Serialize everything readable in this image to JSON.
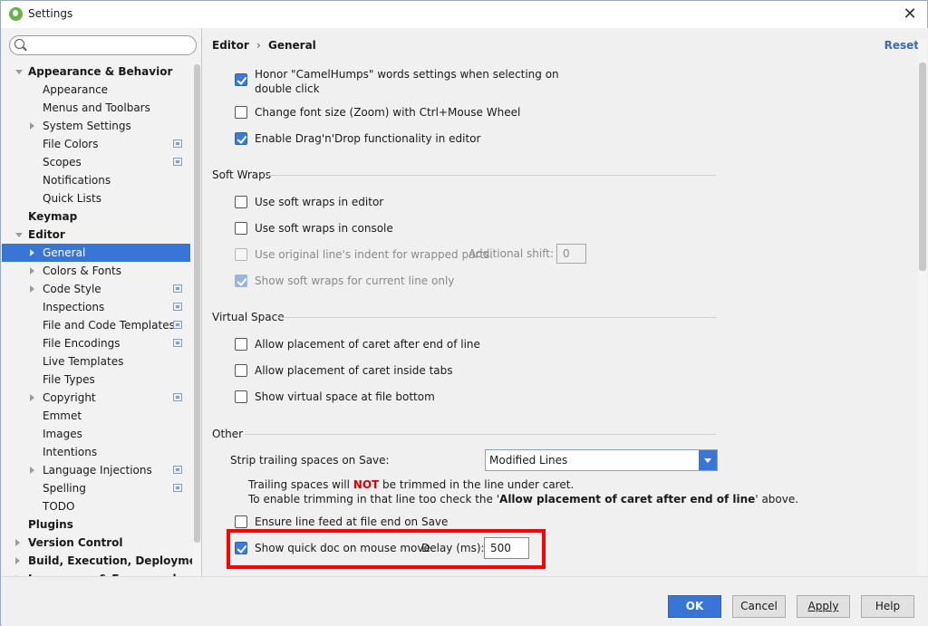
{
  "window": {
    "title": "Settings"
  },
  "sidebar": {
    "search": {
      "placeholder": "",
      "value": ""
    },
    "items": [
      {
        "label": "Appearance & Behavior",
        "bold": true,
        "level": 0,
        "arrow": "down",
        "proj": false
      },
      {
        "label": "Appearance",
        "bold": false,
        "level": 1,
        "arrow": "",
        "proj": false
      },
      {
        "label": "Menus and Toolbars",
        "bold": false,
        "level": 1,
        "arrow": "",
        "proj": false
      },
      {
        "label": "System Settings",
        "bold": false,
        "level": 1,
        "arrow": "right",
        "proj": false
      },
      {
        "label": "File Colors",
        "bold": false,
        "level": 1,
        "arrow": "",
        "proj": true
      },
      {
        "label": "Scopes",
        "bold": false,
        "level": 1,
        "arrow": "",
        "proj": true
      },
      {
        "label": "Notifications",
        "bold": false,
        "level": 1,
        "arrow": "",
        "proj": false
      },
      {
        "label": "Quick Lists",
        "bold": false,
        "level": 1,
        "arrow": "",
        "proj": false
      },
      {
        "label": "Keymap",
        "bold": true,
        "level": 0,
        "arrow": "",
        "proj": false
      },
      {
        "label": "Editor",
        "bold": true,
        "level": 0,
        "arrow": "down",
        "proj": false
      },
      {
        "label": "General",
        "bold": false,
        "level": 1,
        "arrow": "right",
        "proj": false,
        "selected": true
      },
      {
        "label": "Colors & Fonts",
        "bold": false,
        "level": 1,
        "arrow": "right",
        "proj": false
      },
      {
        "label": "Code Style",
        "bold": false,
        "level": 1,
        "arrow": "right",
        "proj": true
      },
      {
        "label": "Inspections",
        "bold": false,
        "level": 1,
        "arrow": "",
        "proj": true
      },
      {
        "label": "File and Code Templates",
        "bold": false,
        "level": 1,
        "arrow": "",
        "proj": true
      },
      {
        "label": "File Encodings",
        "bold": false,
        "level": 1,
        "arrow": "",
        "proj": true
      },
      {
        "label": "Live Templates",
        "bold": false,
        "level": 1,
        "arrow": "",
        "proj": false
      },
      {
        "label": "File Types",
        "bold": false,
        "level": 1,
        "arrow": "",
        "proj": false
      },
      {
        "label": "Copyright",
        "bold": false,
        "level": 1,
        "arrow": "right",
        "proj": true
      },
      {
        "label": "Emmet",
        "bold": false,
        "level": 1,
        "arrow": "",
        "proj": false
      },
      {
        "label": "Images",
        "bold": false,
        "level": 1,
        "arrow": "",
        "proj": false
      },
      {
        "label": "Intentions",
        "bold": false,
        "level": 1,
        "arrow": "",
        "proj": false
      },
      {
        "label": "Language Injections",
        "bold": false,
        "level": 1,
        "arrow": "right",
        "proj": true
      },
      {
        "label": "Spelling",
        "bold": false,
        "level": 1,
        "arrow": "",
        "proj": true
      },
      {
        "label": "TODO",
        "bold": false,
        "level": 1,
        "arrow": "",
        "proj": false
      },
      {
        "label": "Plugins",
        "bold": true,
        "level": 0,
        "arrow": "",
        "proj": false
      },
      {
        "label": "Version Control",
        "bold": true,
        "level": 0,
        "arrow": "right",
        "proj": false
      },
      {
        "label": "Build, Execution, Deployment",
        "bold": true,
        "level": 0,
        "arrow": "right",
        "proj": false
      },
      {
        "label": "Languages & Frameworks",
        "bold": true,
        "level": 0,
        "arrow": "right",
        "proj": false
      }
    ]
  },
  "header": {
    "breadcrumb_parent": "Editor",
    "breadcrumb_separator": "›",
    "breadcrumb_current": "General",
    "reset_label": "Reset"
  },
  "general": {
    "camelhumps_line1": "Honor \"CamelHumps\" words settings when selecting on",
    "camelhumps_line2": "double click",
    "change_font_size": "Change font size (Zoom) with Ctrl+Mouse Wheel",
    "drag_drop": "Enable Drag'n'Drop functionality in editor"
  },
  "soft_wraps": {
    "title": "Soft Wraps",
    "use_in_editor": "Use soft wraps in editor",
    "use_in_console": "Use soft wraps in console",
    "use_original_indent": "Use original line's indent for wrapped parts.",
    "additional_shift_label": "Additional shift:",
    "additional_shift_value": "0",
    "show_current_line": "Show soft wraps for current line only"
  },
  "virtual_space": {
    "title": "Virtual Space",
    "after_end_of_line": "Allow placement of caret after end of line",
    "inside_tabs": "Allow placement of caret inside tabs",
    "at_file_bottom": "Show virtual space at file bottom"
  },
  "other": {
    "title": "Other",
    "strip_label": "Strip trailing spaces on Save:",
    "strip_value": "Modified Lines",
    "hint1_before": "Trailing spaces will ",
    "hint1_not": "NOT",
    "hint1_after": " be trimmed in the line under caret.",
    "hint2_before": "To enable trimming in that line too check the '",
    "hint2_bold": "Allow placement of caret after end of line",
    "hint2_after": "' above.",
    "ensure_line_feed": "Ensure line feed at file end on Save",
    "quick_doc": "Show quick doc on mouse move",
    "delay_label": "Delay (ms):",
    "delay_value": "500"
  },
  "buttons": {
    "ok": "OK",
    "cancel": "Cancel",
    "apply": "Apply",
    "help": "Help"
  },
  "colors": {
    "accent": "#3875d7",
    "highlight_box": "#ff0000",
    "not_text": "#e00000"
  }
}
